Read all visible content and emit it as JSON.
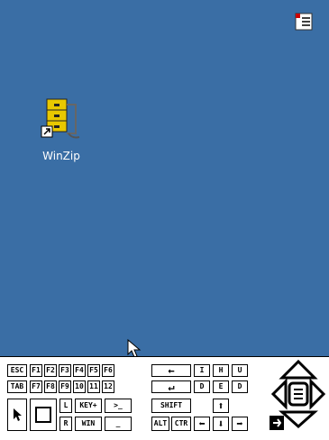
{
  "desktop": {
    "background": "#3a6ea5",
    "tray_icon": "menu-list-icon",
    "icons": [
      {
        "label": "WinZip",
        "icon": "winzip-icon"
      }
    ]
  },
  "keyboard": {
    "row1": [
      "ESC",
      "F1",
      "F2",
      "F3",
      "F4",
      "F5",
      "F6",
      "←",
      "I",
      "H",
      "U"
    ],
    "row2": [
      "TAB",
      "F7",
      "F8",
      "F9",
      "10",
      "11",
      "12",
      "↵",
      "D",
      "E",
      "D"
    ],
    "row3a": [
      "L",
      "KEY+",
      ">_",
      "SHIFT",
      "⬆"
    ],
    "row3b": [
      "R",
      "WIN",
      "_",
      "ALT",
      "CTR",
      "⬅",
      "⬇",
      "➡"
    ]
  }
}
